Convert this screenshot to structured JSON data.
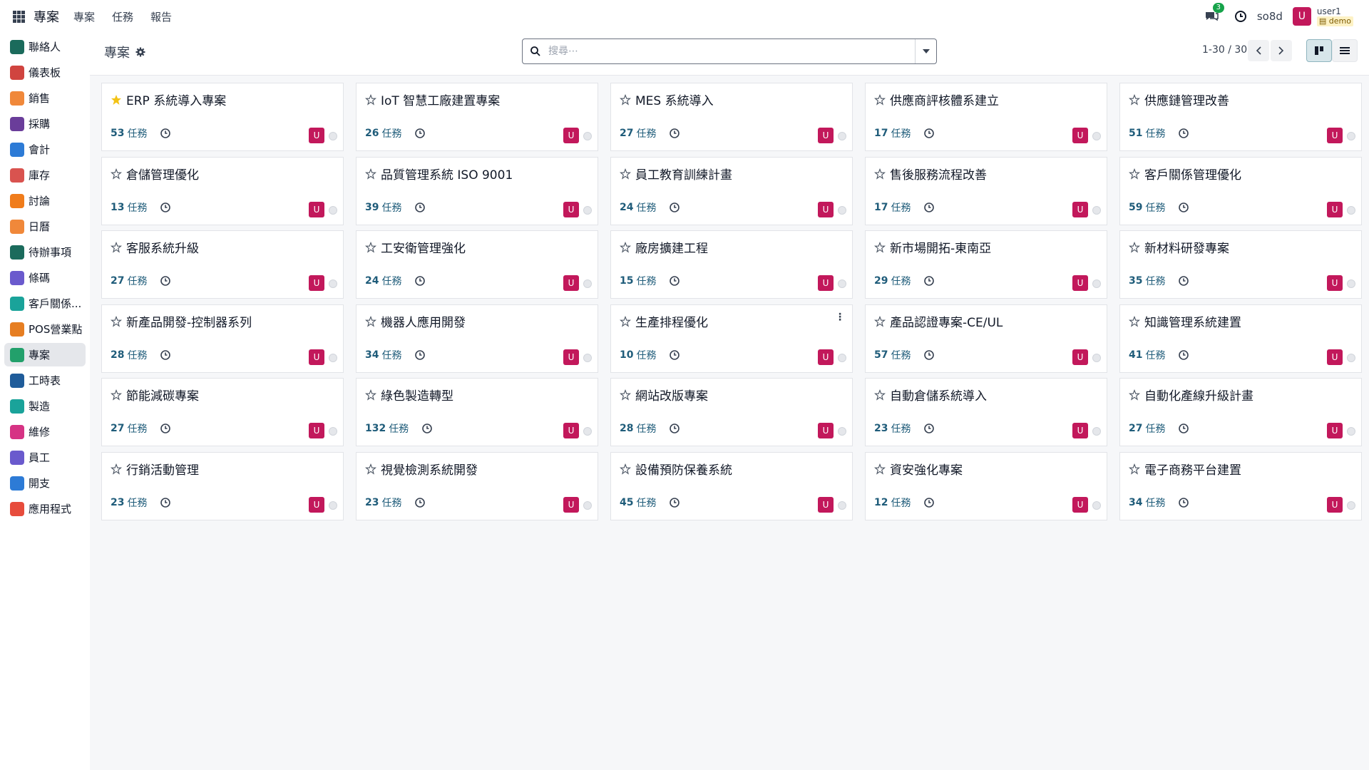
{
  "topbar": {
    "app_title": "專案",
    "menu": [
      "專案",
      "任務",
      "報告"
    ],
    "chat_badge": "3",
    "db_name": "so8d",
    "user_initial": "U",
    "user_name": "user1",
    "user_db": "demo"
  },
  "sidebar": {
    "items": [
      {
        "label": "聯絡人",
        "icon": "contacts-icon",
        "color": "#1b6b5c"
      },
      {
        "label": "儀表板",
        "icon": "dashboard-icon",
        "color": "#d0443f"
      },
      {
        "label": "銷售",
        "icon": "sales-icon",
        "color": "#f0883a"
      },
      {
        "label": "採購",
        "icon": "purchase-icon",
        "color": "#6a3d9a"
      },
      {
        "label": "會計",
        "icon": "accounting-icon",
        "color": "#2d7bd6"
      },
      {
        "label": "庫存",
        "icon": "inventory-icon",
        "color": "#d9534f"
      },
      {
        "label": "討論",
        "icon": "discuss-icon",
        "color": "#f07c1b"
      },
      {
        "label": "日曆",
        "icon": "calendar-icon",
        "color": "#f0883a"
      },
      {
        "label": "待辦事項",
        "icon": "todo-icon",
        "color": "#1b6b5c"
      },
      {
        "label": "條碼",
        "icon": "barcode-icon",
        "color": "#6a5acd"
      },
      {
        "label": "客戶關係...",
        "icon": "crm-icon",
        "color": "#1aa39a"
      },
      {
        "label": "POS營業點",
        "icon": "pos-icon",
        "color": "#e67e22"
      },
      {
        "label": "專案",
        "icon": "project-icon",
        "color": "#22a06b",
        "active": true
      },
      {
        "label": "工時表",
        "icon": "timesheet-icon",
        "color": "#1f5c9a"
      },
      {
        "label": "製造",
        "icon": "manufacturing-icon",
        "color": "#1aa39a"
      },
      {
        "label": "維修",
        "icon": "repair-icon",
        "color": "#d63384"
      },
      {
        "label": "員工",
        "icon": "employees-icon",
        "color": "#6a5acd"
      },
      {
        "label": "開支",
        "icon": "expenses-icon",
        "color": "#2d7bd6"
      },
      {
        "label": "應用程式",
        "icon": "apps-store-icon",
        "color": "#e74c3c"
      }
    ]
  },
  "control": {
    "breadcrumb": "專案",
    "search_placeholder": "搜尋⋯",
    "pager": "1-30 / 30"
  },
  "task_label": "任務",
  "projects": [
    {
      "name": "ERP 系統導入專案",
      "tasks": "53",
      "favorite": true
    },
    {
      "name": "IoT 智慧工廠建置專案",
      "tasks": "26"
    },
    {
      "name": "MES 系統導入",
      "tasks": "27"
    },
    {
      "name": "供應商評核體系建立",
      "tasks": "17"
    },
    {
      "name": "供應鏈管理改善",
      "tasks": "51"
    },
    {
      "name": "倉儲管理優化",
      "tasks": "13"
    },
    {
      "name": "品質管理系統 ISO 9001",
      "tasks": "39"
    },
    {
      "name": "員工教育訓練計畫",
      "tasks": "24"
    },
    {
      "name": "售後服務流程改善",
      "tasks": "17"
    },
    {
      "name": "客戶關係管理優化",
      "tasks": "59"
    },
    {
      "name": "客服系統升級",
      "tasks": "27"
    },
    {
      "name": "工安衛管理強化",
      "tasks": "24"
    },
    {
      "name": "廠房擴建工程",
      "tasks": "15"
    },
    {
      "name": "新市場開拓-東南亞",
      "tasks": "29"
    },
    {
      "name": "新材料研發專案",
      "tasks": "35"
    },
    {
      "name": "新產品開發-控制器系列",
      "tasks": "28"
    },
    {
      "name": "機器人應用開發",
      "tasks": "34"
    },
    {
      "name": "生產排程優化",
      "tasks": "10",
      "menu": true
    },
    {
      "name": "產品認證專案-CE/UL",
      "tasks": "57"
    },
    {
      "name": "知識管理系統建置",
      "tasks": "41"
    },
    {
      "name": "節能減碳專案",
      "tasks": "27"
    },
    {
      "name": "綠色製造轉型",
      "tasks": "132"
    },
    {
      "name": "網站改版專案",
      "tasks": "28"
    },
    {
      "name": "自動倉儲系統導入",
      "tasks": "23"
    },
    {
      "name": "自動化產線升級計畫",
      "tasks": "27"
    },
    {
      "name": "行銷活動管理",
      "tasks": "23"
    },
    {
      "name": "視覺檢測系統開發",
      "tasks": "23"
    },
    {
      "name": "設備預防保養系統",
      "tasks": "45"
    },
    {
      "name": "資安強化專案",
      "tasks": "12"
    },
    {
      "name": "電子商務平台建置",
      "tasks": "34"
    }
  ],
  "card_avatar_initial": "U"
}
